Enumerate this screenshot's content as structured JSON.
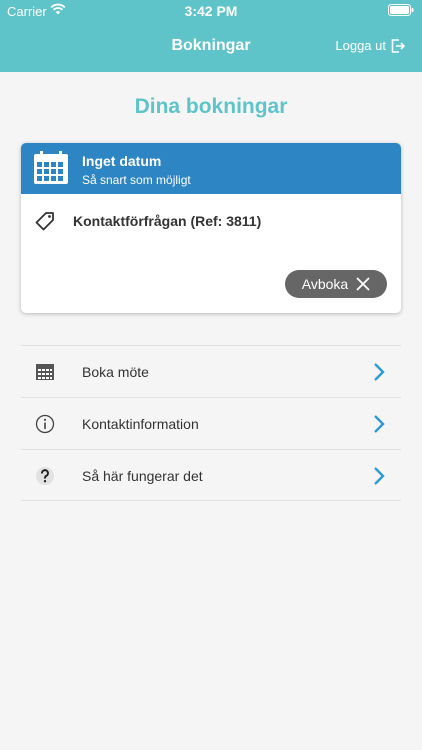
{
  "status": {
    "carrier": "Carrier",
    "time": "3:42 PM"
  },
  "header": {
    "title": "Bokningar",
    "logout_label": "Logga ut"
  },
  "page": {
    "title": "Dina bokningar"
  },
  "booking": {
    "date_title": "Inget datum",
    "date_subtitle": "Så snart som möjligt",
    "request": "Kontaktförfrågan (Ref: 3811)",
    "cancel_label": "Avboka"
  },
  "menu": {
    "items": [
      {
        "label": "Boka möte",
        "icon": "calendar-icon"
      },
      {
        "label": "Kontaktinformation",
        "icon": "info-icon"
      },
      {
        "label": "Så här fungerar det",
        "icon": "question-icon"
      }
    ]
  },
  "colors": {
    "accent": "#5fc4ca",
    "card_header": "#2d85c3",
    "chevron": "#2d9ad6",
    "button": "#666666"
  }
}
